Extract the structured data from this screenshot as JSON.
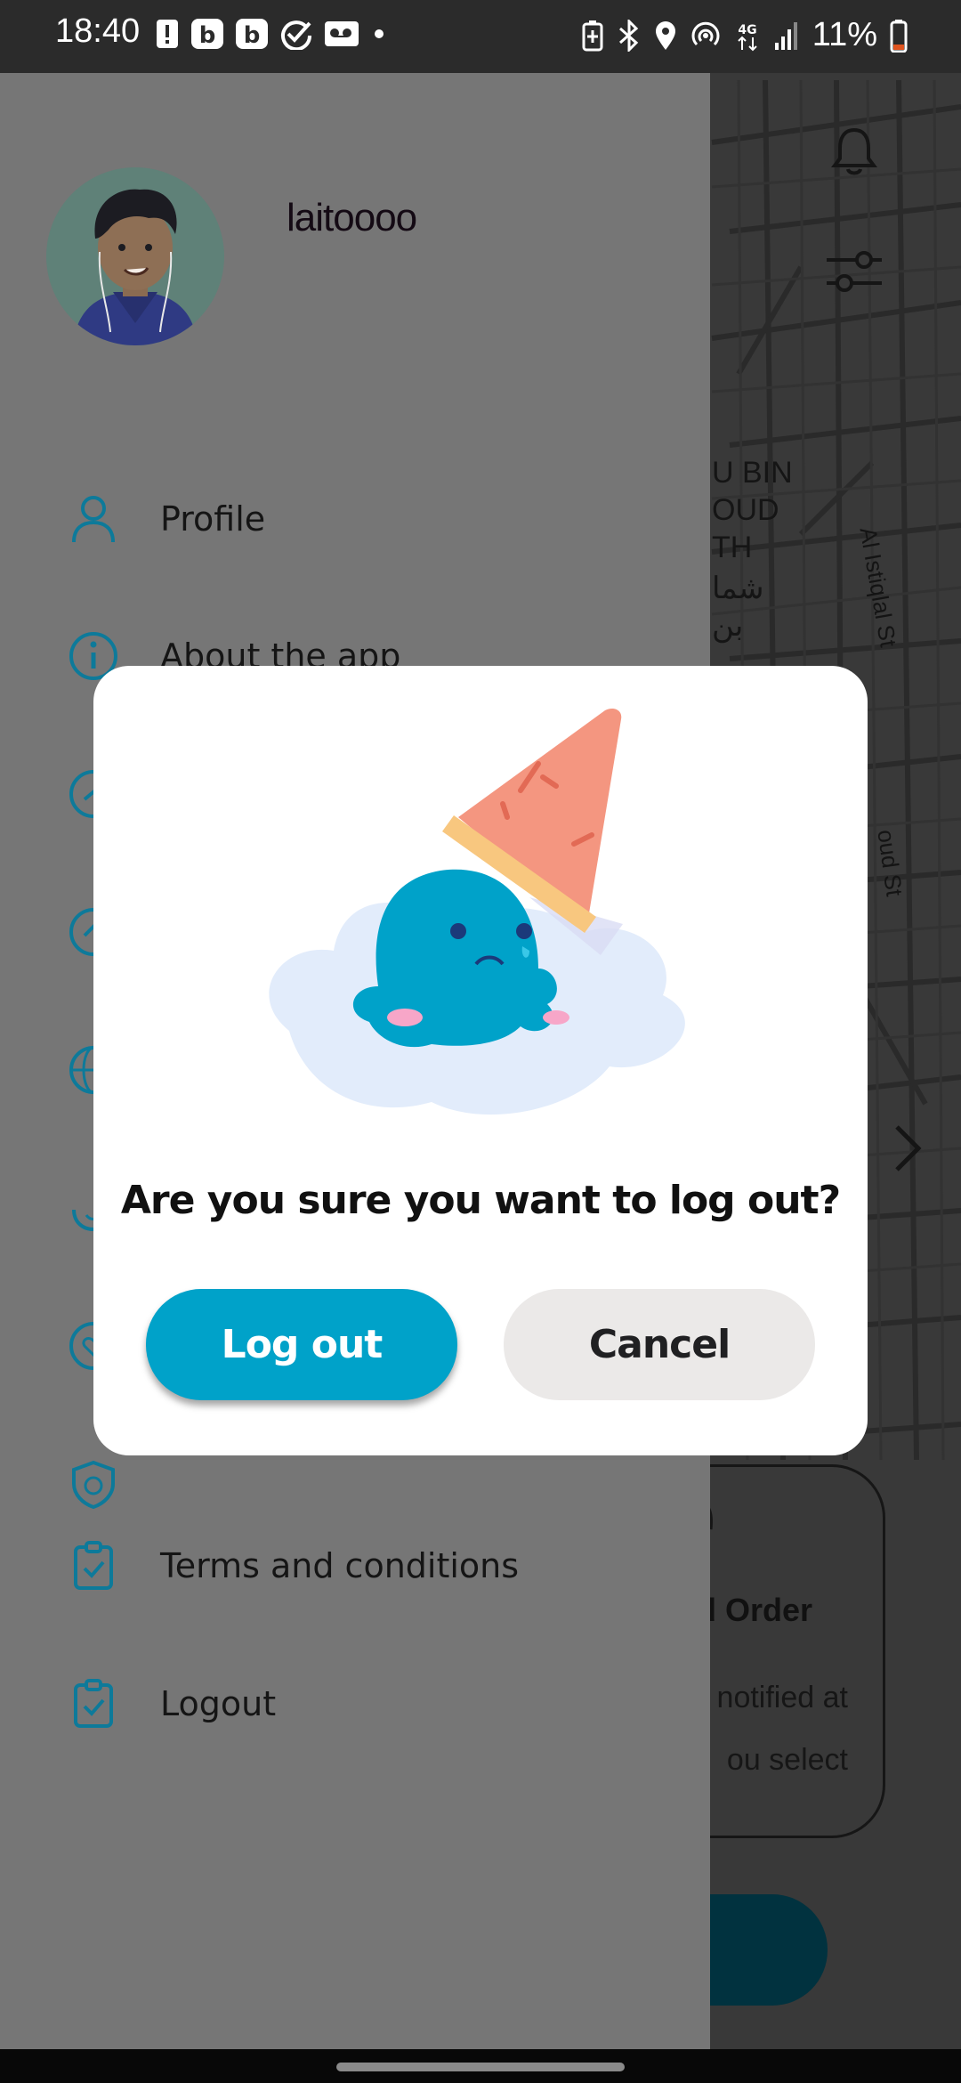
{
  "status_bar": {
    "time": "18:40",
    "battery": "11%",
    "left_icons": [
      "alert-icon",
      "b-app-icon",
      "b-app-icon",
      "check-icon",
      "voicemail-icon",
      "dot-icon"
    ],
    "right_icons": [
      "battery-saver-icon",
      "bluetooth-icon",
      "location-icon",
      "hotspot-icon",
      "4g-icon",
      "signal-icon",
      "battery-icon"
    ]
  },
  "drawer": {
    "username": "laitoooo",
    "menu": [
      {
        "label": "Profile",
        "icon": "person-icon"
      },
      {
        "label": "About the app",
        "icon": "info-icon"
      },
      {
        "label": "",
        "icon": "circle-icon"
      },
      {
        "label": "",
        "icon": "circle-icon"
      },
      {
        "label": "",
        "icon": "globe-icon"
      },
      {
        "label": "",
        "icon": "sparkle-face-icon"
      },
      {
        "label": "",
        "icon": "heart-circle-icon"
      },
      {
        "label": "",
        "icon": "shield-icon"
      },
      {
        "label": "Terms and conditions",
        "icon": "clipboard-check-icon"
      },
      {
        "label": "Logout",
        "icon": "clipboard-check-icon"
      }
    ]
  },
  "background": {
    "map_label_en": "U BIN\nOUD\nTH",
    "map_label_ar": "شما\nبن",
    "street_1": "Al Istiqlal St",
    "street_2": "oud St",
    "order_title": "d Order",
    "order_line_1": "notified at",
    "order_line_2": "ou select"
  },
  "dialog": {
    "message": "Are you sure you want to log out?",
    "logout_label": "Log out",
    "cancel_label": "Cancel"
  },
  "colors": {
    "accent": "#00a2c9",
    "icon_teal": "#0d7a9a",
    "cancel_bg": "#ebe9e8",
    "drawer_bg": "#767676"
  }
}
